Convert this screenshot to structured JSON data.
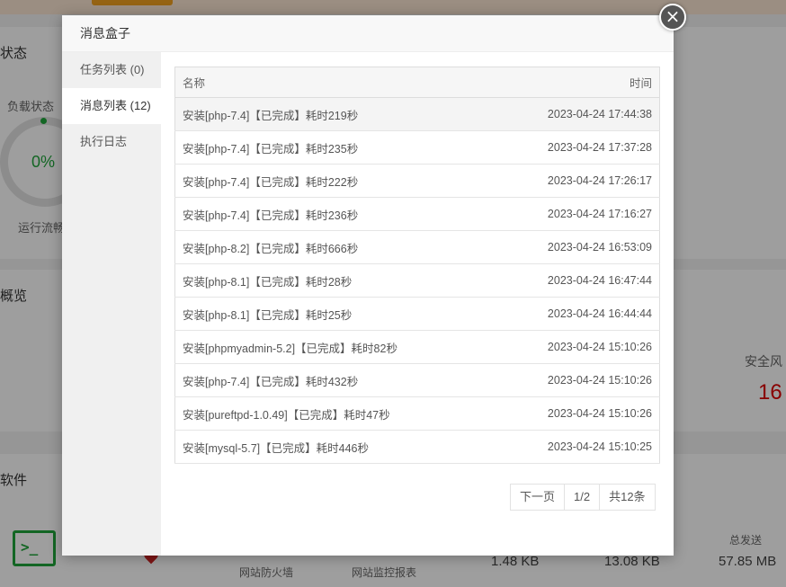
{
  "background": {
    "section_status": "状态",
    "load_label": "负载状态",
    "load_value": "0%",
    "run_label": "运行流畅",
    "section_overview": "概览",
    "risk_label": "安全风",
    "risk_value": "16",
    "section_software": "软件",
    "terminal_glyph": ">_",
    "firewall_label": "网站防火墙",
    "monitor_label": "网站监控报表",
    "total_sent_label": "总发送",
    "traffic_1": "1.48 KB",
    "traffic_2": "13.08 KB",
    "traffic_3": "57.85 MB"
  },
  "modal": {
    "title": "消息盒子",
    "close_glyph": "×",
    "sidebar": [
      {
        "label": "任务列表 (0)"
      },
      {
        "label": "消息列表 (12)"
      },
      {
        "label": "执行日志"
      }
    ],
    "table": {
      "col_name": "名称",
      "col_time": "时间",
      "rows": [
        {
          "name": "安装[php-7.4]【已完成】耗时219秒",
          "time": "2023-04-24 17:44:38"
        },
        {
          "name": "安装[php-7.4]【已完成】耗时235秒",
          "time": "2023-04-24 17:37:28"
        },
        {
          "name": "安装[php-7.4]【已完成】耗时222秒",
          "time": "2023-04-24 17:26:17"
        },
        {
          "name": "安装[php-7.4]【已完成】耗时236秒",
          "time": "2023-04-24 17:16:27"
        },
        {
          "name": "安装[php-8.2]【已完成】耗时666秒",
          "time": "2023-04-24 16:53:09"
        },
        {
          "name": "安装[php-8.1]【已完成】耗时28秒",
          "time": "2023-04-24 16:47:44"
        },
        {
          "name": "安装[php-8.1]【已完成】耗时25秒",
          "time": "2023-04-24 16:44:44"
        },
        {
          "name": "安装[phpmyadmin-5.2]【已完成】耗时82秒",
          "time": "2023-04-24 15:10:26"
        },
        {
          "name": "安装[php-7.4]【已完成】耗时432秒",
          "time": "2023-04-24 15:10:26"
        },
        {
          "name": "安装[pureftpd-1.0.49]【已完成】耗时47秒",
          "time": "2023-04-24 15:10:26"
        },
        {
          "name": "安装[mysql-5.7]【已完成】耗时446秒",
          "time": "2023-04-24 15:10:25"
        }
      ]
    },
    "pager": {
      "next_label": "下一页",
      "page": "1/2",
      "total": "共12条"
    }
  }
}
